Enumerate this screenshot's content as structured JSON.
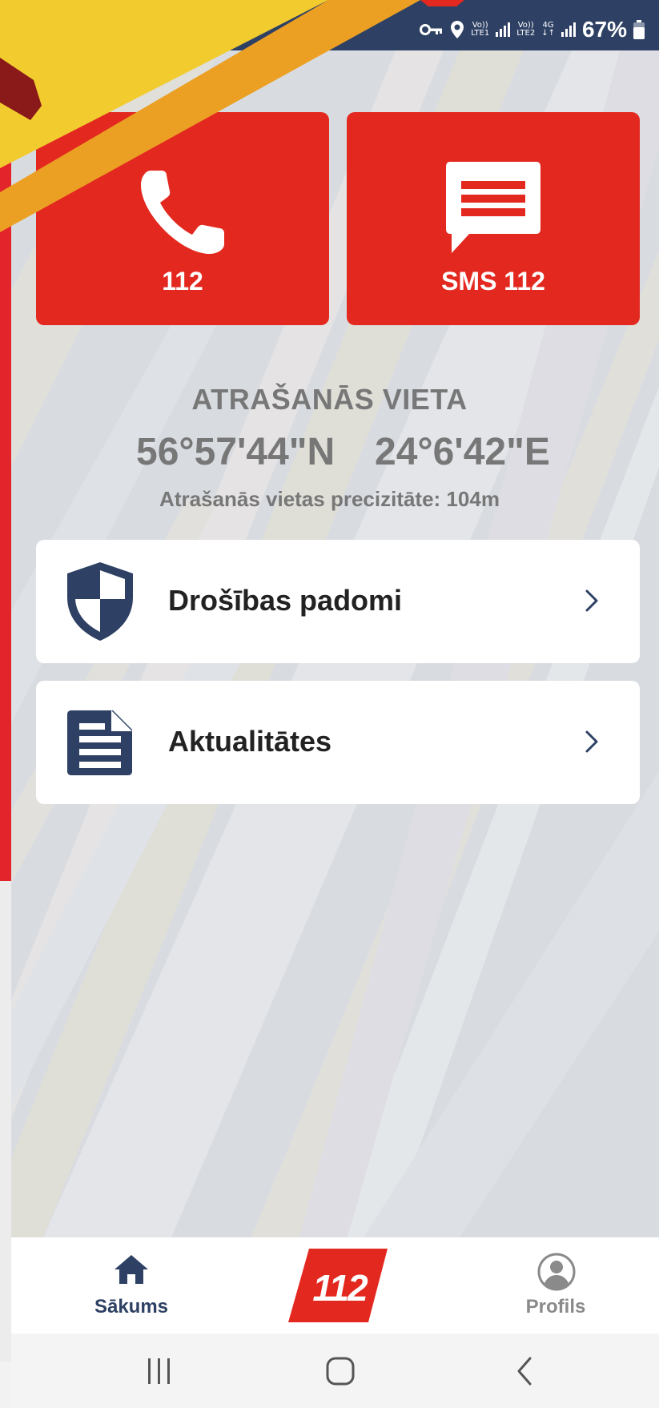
{
  "status_bar": {
    "icons": [
      "vpn-key-icon",
      "location-pin-icon",
      "volte-lte1-icon",
      "signal-icon",
      "volte-lte2-icon",
      "4g-icon",
      "signal-icon",
      "battery-icon"
    ],
    "volte1_top": "Vo))",
    "volte1_bottom": "LTE1",
    "volte2_top": "Vo))",
    "volte2_bottom": "LTE2",
    "net_type": "4G",
    "battery_percent": "67%"
  },
  "tiles": {
    "call": {
      "label": "112",
      "icon": "phone-icon"
    },
    "sms": {
      "label": "SMS 112",
      "icon": "message-icon"
    }
  },
  "location": {
    "title": "ATRAŠANĀS VIETA",
    "latitude": "56°57'44\"N",
    "longitude": "24°6'42\"E",
    "accuracy": "Atrašanās vietas precizitāte: 104m"
  },
  "menu": [
    {
      "label": "Drošības padomi",
      "icon": "shield-icon"
    },
    {
      "label": "Aktualitātes",
      "icon": "document-icon"
    }
  ],
  "bottom_nav": {
    "home_label": "Sākums",
    "logo_text": "112",
    "profile_label": "Profils"
  },
  "colors": {
    "brand_red": "#e3291f",
    "navy": "#2e4164",
    "muted_text": "#777777"
  }
}
